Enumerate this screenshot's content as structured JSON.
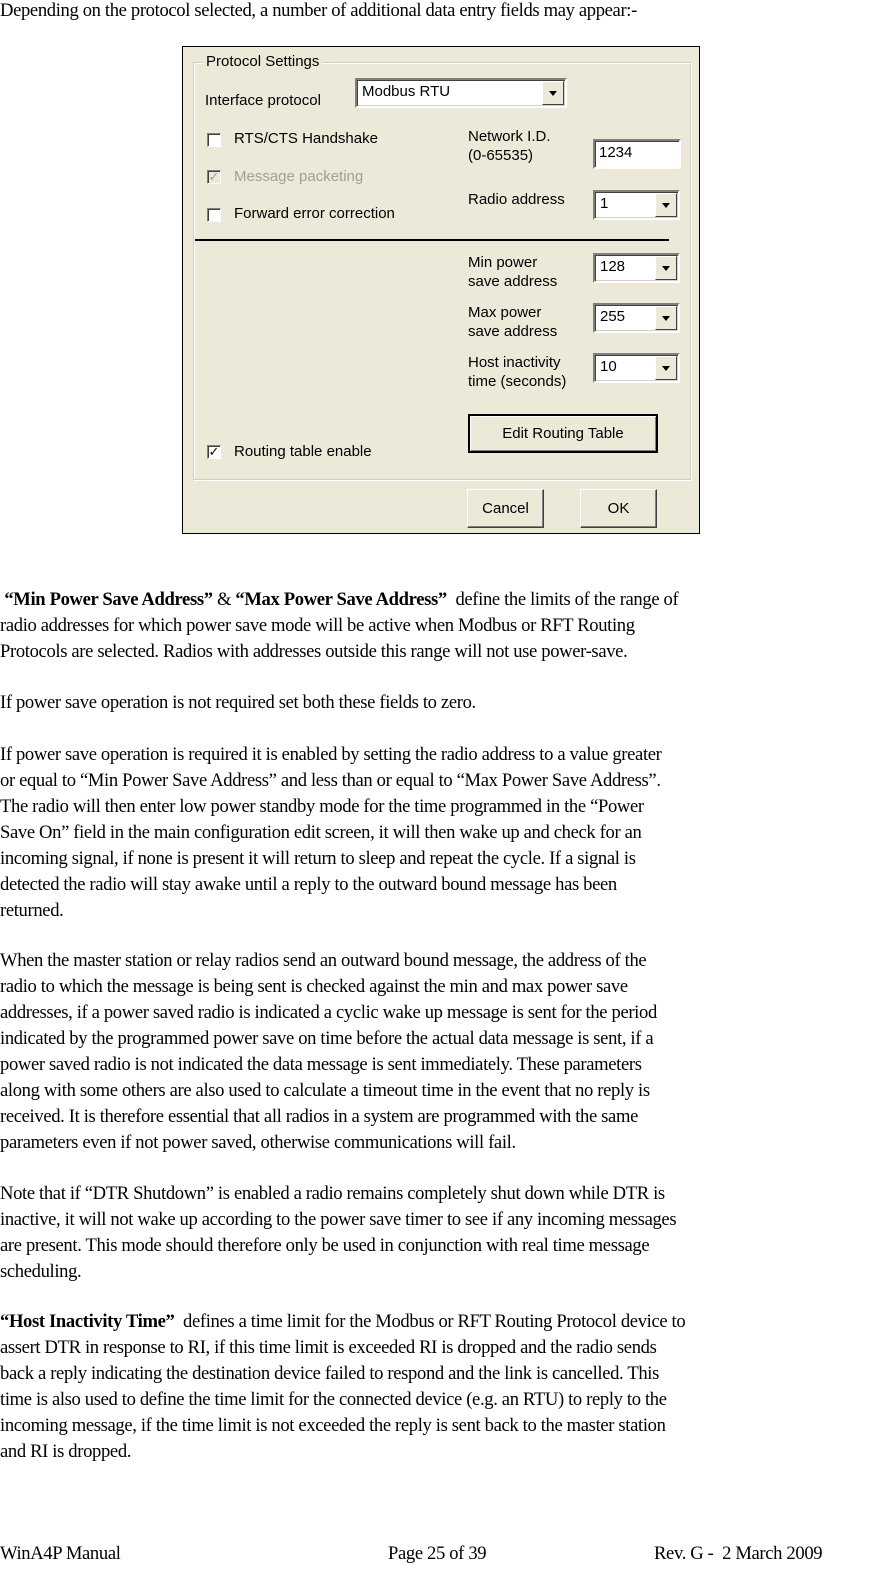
{
  "intro": "Depending on the protocol selected, a number of additional data entry fields may appear:-",
  "dialog": {
    "group_title": "Protocol Settings",
    "interface_protocol_label": "Interface protocol",
    "interface_protocol_value": "Modbus RTU",
    "rts_cts_label": "RTS/CTS Handshake",
    "rts_cts_checked": false,
    "message_packeting_label": "Message packeting",
    "message_packeting_checked": true,
    "message_packeting_disabled": true,
    "fec_label": "Forward error correction",
    "fec_checked": false,
    "network_id_label_1": "Network I.D.",
    "network_id_label_2": "(0-65535)",
    "network_id_value": "1234",
    "radio_address_label": "Radio address",
    "radio_address_value": "1",
    "min_power_label_1": "Min power",
    "min_power_label_2": "save address",
    "min_power_value": "128",
    "max_power_label_1": "Max power",
    "max_power_label_2": "save address",
    "max_power_value": "255",
    "host_inactivity_label_1": "Host inactivity",
    "host_inactivity_label_2": "time (seconds)",
    "host_inactivity_value": "10",
    "edit_routing_button": "Edit Routing Table",
    "routing_enable_label": "Routing table enable",
    "routing_enable_checked": true,
    "cancel_button": "Cancel",
    "ok_button": "OK",
    "check_glyph": "✓"
  },
  "paragraphs": {
    "p1": {
      "bold1": "“Min Power Save Address”",
      "amp": " & ",
      "bold2": "“Max Power Save Address”",
      "l1_rest": "  define the limits of the range of",
      "l2": "radio addresses for which power save mode will be active when Modbus or RFT Routing",
      "l3": "Protocols are selected.  Radios with addresses outside this range will not use power-save."
    },
    "p2": "If power save operation is not required set both these fields to zero.",
    "p3": [
      "If power save operation is required it is enabled by setting the radio address to a value greater",
      "or equal to “Min Power Save Address” and less than or equal to “Max Power Save Address”.",
      "The radio will then enter low power standby mode for the time programmed in the “Power",
      "Save On” field in the main configuration edit screen, it will then wake up and check for an",
      "incoming signal, if none is present it will return to sleep and repeat the cycle. If a signal is",
      "detected the radio will stay awake until a reply to the outward bound message has been",
      "returned."
    ],
    "p4": [
      "When the master station or relay radios send an outward bound message, the address of the",
      "radio to which the message is being sent is checked against the min and max power save",
      "addresses, if a power saved radio is indicated a cyclic wake up message is sent for the period",
      "indicated by the programmed power save on time before the actual data message is sent, if a",
      "power saved radio is not indicated the data message is sent immediately. These parameters",
      "along with some others are also used to calculate a timeout time in the event that no reply is",
      "received. It is therefore essential that all radios in a system are programmed with the same",
      "parameters even if not power saved, otherwise communications will fail."
    ],
    "p5": [
      "Note that if “DTR Shutdown” is enabled a radio remains completely shut down while DTR is",
      "inactive, it will not wake up according to the power save timer to see if any incoming messages",
      "are present. This mode should therefore only be used in conjunction with real time message",
      "scheduling."
    ],
    "p6": {
      "bold": "“Host Inactivity Time”",
      "l1_rest": "  defines a time limit for the Modbus or RFT Routing Protocol device to",
      "lines": [
        "assert DTR in response to RI, if this time limit is exceeded RI is dropped and the radio sends",
        "back a reply indicating the destination device failed to respond and the link is cancelled. This",
        "time is also used to define the time limit for the connected device (e.g. an RTU) to reply to the",
        "incoming message, if the time limit is not exceeded the reply is sent back to the master station",
        "and RI is dropped."
      ]
    }
  },
  "footer": {
    "left": "WinA4P Manual",
    "center": "Page 25 of 39",
    "right": "Rev. G -  2 March 2009"
  }
}
